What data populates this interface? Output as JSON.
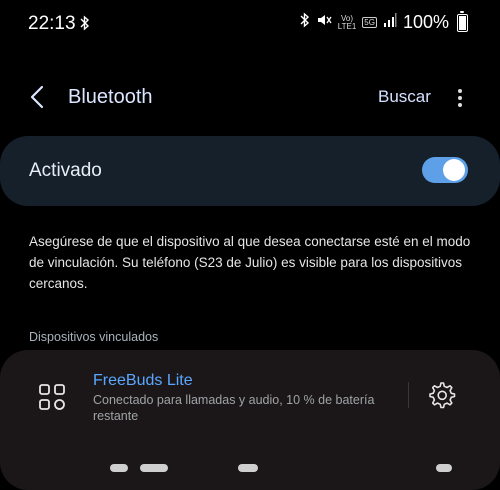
{
  "status_bar": {
    "time": "22:13",
    "volte_top": "Vo)",
    "volte_bottom": "LTE1",
    "network_5g": "5G",
    "battery_percent": "100%"
  },
  "header": {
    "title": "Bluetooth",
    "search_label": "Buscar"
  },
  "toggle": {
    "label": "Activado",
    "state": "on"
  },
  "description": "Asegúrese de que el dispositivo al que desea conectarse esté en el modo de vinculación. Su teléfono (S23 de Julio) es visible para los dispositivos cercanos.",
  "paired_section": {
    "label": "Dispositivos vinculados"
  },
  "devices": [
    {
      "name": "FreeBuds Lite",
      "status": "Conectado para llamadas y audio, 10 % de batería restante"
    }
  ],
  "colors": {
    "accent": "#5aa7ff",
    "toggle_on": "#5ea0e8",
    "card_bg": "#15202b",
    "device_card_bg": "#1b1718"
  }
}
